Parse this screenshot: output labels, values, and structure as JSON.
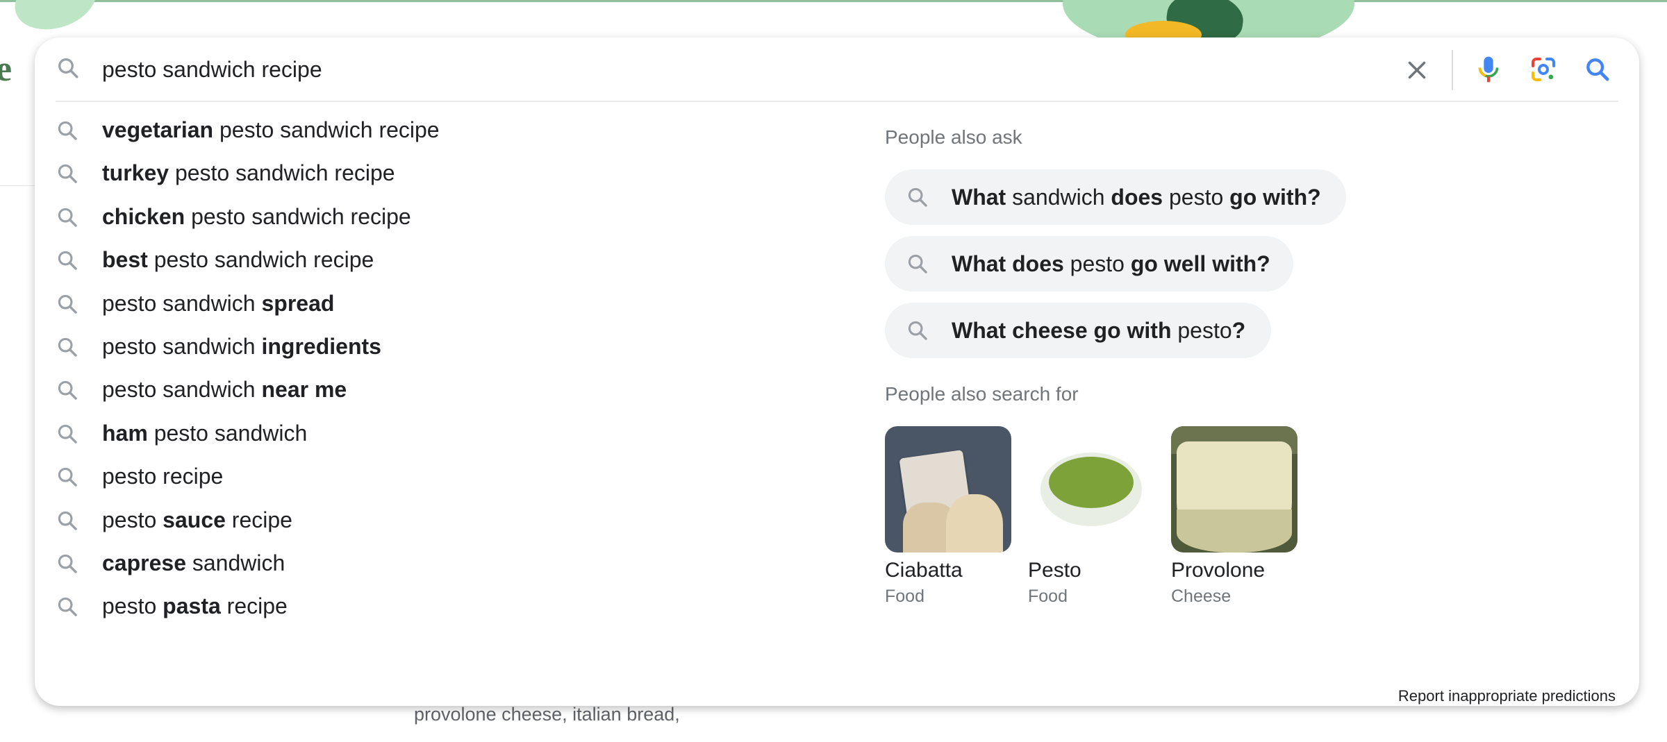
{
  "background": {
    "logo_fragment": "e",
    "snippet_text": "provolone cheese, italian bread,"
  },
  "search": {
    "query": "pesto sandwich recipe",
    "icons": {
      "leading": "search-icon",
      "clear": "close-icon",
      "voice": "microphone-icon",
      "lens": "camera-lens-icon",
      "submit": "search-icon"
    },
    "colors": {
      "blue": "#4285f4",
      "red": "#ea4335",
      "yellow": "#fbbc04",
      "green": "#34a853",
      "icon_gray": "#9aa0a6"
    }
  },
  "suggestions": [
    {
      "pre": "",
      "bold": "vegetarian",
      "post": " pesto sandwich recipe"
    },
    {
      "pre": "",
      "bold": "turkey",
      "post": " pesto sandwich recipe"
    },
    {
      "pre": "",
      "bold": "chicken",
      "post": " pesto sandwich recipe"
    },
    {
      "pre": "",
      "bold": "best",
      "post": " pesto sandwich recipe"
    },
    {
      "pre": "pesto sandwich ",
      "bold": "spread",
      "post": ""
    },
    {
      "pre": "pesto sandwich ",
      "bold": "ingredients",
      "post": ""
    },
    {
      "pre": "pesto sandwich ",
      "bold": "near me",
      "post": ""
    },
    {
      "pre": "",
      "bold": "ham",
      "post": " pesto sandwich"
    },
    {
      "pre": "pesto recipe",
      "bold": "",
      "post": ""
    },
    {
      "pre": "pesto ",
      "bold": "sauce",
      "post": " recipe"
    },
    {
      "pre": "",
      "bold": "caprese",
      "post": " sandwich"
    },
    {
      "pre": "pesto ",
      "bold": "pasta",
      "post": " recipe"
    }
  ],
  "people_also_ask": {
    "title": "People also ask",
    "questions": [
      {
        "a": "What",
        "b": " sandwich ",
        "c": "does",
        "d": " pesto ",
        "e": "go with?"
      },
      {
        "a": "What does",
        "b": " pesto ",
        "c": "go well with?",
        "d": "",
        "e": ""
      },
      {
        "a": "What cheese go with",
        "b": " pesto",
        "c": "?",
        "d": "",
        "e": ""
      }
    ]
  },
  "people_also_search_for": {
    "title": "People also search for",
    "items": [
      {
        "name": "Ciabatta",
        "type": "Food"
      },
      {
        "name": "Pesto",
        "type": "Food"
      },
      {
        "name": "Provolone",
        "type": "Cheese"
      }
    ]
  },
  "footer": {
    "report_label": "Report inappropriate predictions"
  }
}
